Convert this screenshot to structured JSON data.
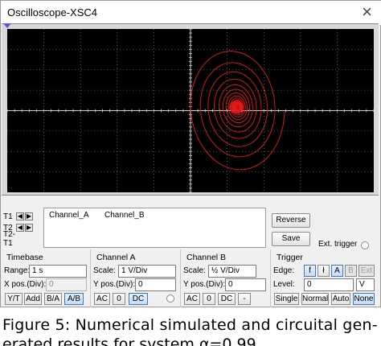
{
  "window": {
    "title": "Oscilloscope-XSC4",
    "close_glyph": "×"
  },
  "screen": {
    "background": "#000000",
    "trace_color": "#e81919",
    "grid_color": "#9a9a9a"
  },
  "cursor": {
    "rows": [
      "T1",
      "T2",
      "T2-T1"
    ],
    "columns": [
      "Channel_A",
      "Channel_B"
    ]
  },
  "buttons": {
    "reverse": "Reverse",
    "save": "Save",
    "ext_trigger": "Ext. trigger"
  },
  "timebase": {
    "title": "Timebase",
    "scale_label": "Range:",
    "scale_value": "1 s",
    "xpos_label": "X pos.(Div):",
    "xpos_value": "0",
    "modes": [
      "Y/T",
      "Add",
      "B/A",
      "A/B"
    ],
    "active_mode": "A/B"
  },
  "channel_a": {
    "title": "Channel A",
    "scale_label": "Scale:",
    "scale_value": "1 V/Div",
    "ypos_label": "Y pos.(Div):",
    "ypos_value": "0",
    "coupling": [
      "AC",
      "0",
      "DC"
    ],
    "active_coupling": "DC"
  },
  "channel_b": {
    "title": "Channel B",
    "scale_label": "Scale:",
    "scale_value": "½ V/Div",
    "ypos_label": "Y pos.(Div):",
    "ypos_value": "0",
    "coupling": [
      "AC",
      "0",
      "DC",
      "-"
    ]
  },
  "trigger": {
    "title": "Trigger",
    "edge_label": "Edge:",
    "edge_buttons": [
      "f",
      "ł",
      "A",
      "B",
      "Ext"
    ],
    "level_label": "Level:",
    "level_value": "0",
    "level_unit": "V",
    "modes": [
      "Single",
      "Normal",
      "Auto",
      "None"
    ],
    "active_mode": "None"
  },
  "caption": {
    "line1": "Figure 5: Numerical simulated and circuital gen-",
    "line2": "erated results for system α=0.99"
  }
}
